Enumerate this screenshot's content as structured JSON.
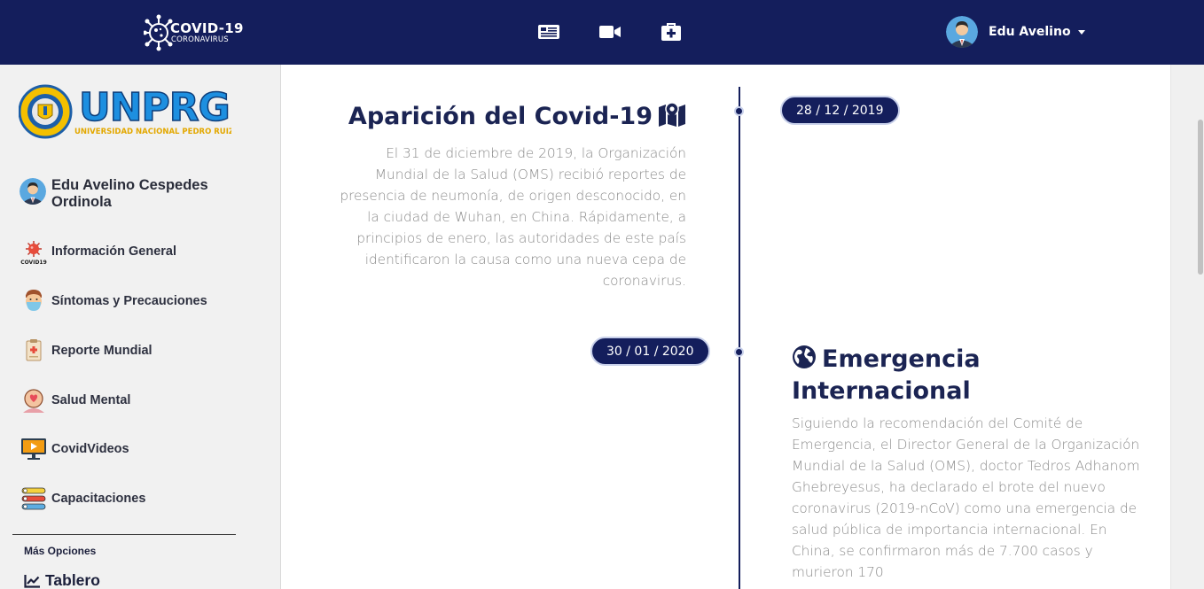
{
  "navbar": {
    "brand_title": "COVID-19",
    "brand_subtitle": "CORONAVIRUS",
    "icons": [
      "newspaper-icon",
      "video-camera-icon",
      "medkit-icon"
    ],
    "user_name": "Edu Avelino"
  },
  "sidebar": {
    "logo_text": "UNPRG",
    "logo_subtext": "UNIVERSIDAD NACIONAL PEDRO RUIZ GALLO",
    "profile_name": "Edu Avelino Cespedes Ordinola",
    "items": [
      {
        "label": "Información General",
        "icon": "covid-virus-icon"
      },
      {
        "label": "Síntomas y Precauciones",
        "icon": "masked-person-icon"
      },
      {
        "label": "Reporte Mundial",
        "icon": "clipboard-report-icon"
      },
      {
        "label": "Salud Mental",
        "icon": "mental-health-icon"
      },
      {
        "label": "CovidVideos",
        "icon": "video-screen-icon"
      },
      {
        "label": "Capacitaciones",
        "icon": "training-steps-icon"
      }
    ],
    "more_label": "Más Opciones",
    "tablero_label": "Tablero"
  },
  "timeline": {
    "events": [
      {
        "date": "28 / 12 / 2019",
        "title": "Aparición del Covid-19",
        "icon": "map-marker-icon",
        "text": "El 31 de diciembre de 2019, la Organización Mundial de la Salud (OMS) recibió reportes de presencia de neumonía, de origen desconocido, en la ciudad de Wuhan, en China. Rápidamente, a principios de enero, las autoridades de este país identificaron la causa como una nueva cepa de coronavirus."
      },
      {
        "date": "30 / 01 / 2020",
        "title": "Emergencia Internacional",
        "icon": "globe-icon",
        "text": "Siguiendo la recomendación del Comité de Emergencia, el Director General de la Organización Mundial de la Salud (OMS), doctor Tedros Adhanom Ghebreyesus, ha declarado el brote del nuevo coronavirus (2019-nCoV) como una emergencia de salud pública de importancia internacional. En China, se confirmaron más de 7.700 casos y murieron 170"
      }
    ]
  },
  "colors": {
    "navy": "#141e5c",
    "title": "#1b2453",
    "body_text": "#8b8b8b",
    "sidebar_bg": "#f1f1f1"
  }
}
